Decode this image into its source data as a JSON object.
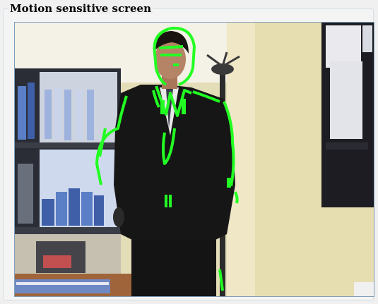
{
  "window": {
    "group_title": "Motion sensitive screen"
  },
  "camera_feed": {
    "description_kind": "live-camera-frame",
    "motion_overlay_color": "#22ff22",
    "wall_color": "#e3ddb8",
    "suit_color": "#141414",
    "shelf_color": "#2a2d36",
    "folder_color": "#5b7fc6"
  }
}
